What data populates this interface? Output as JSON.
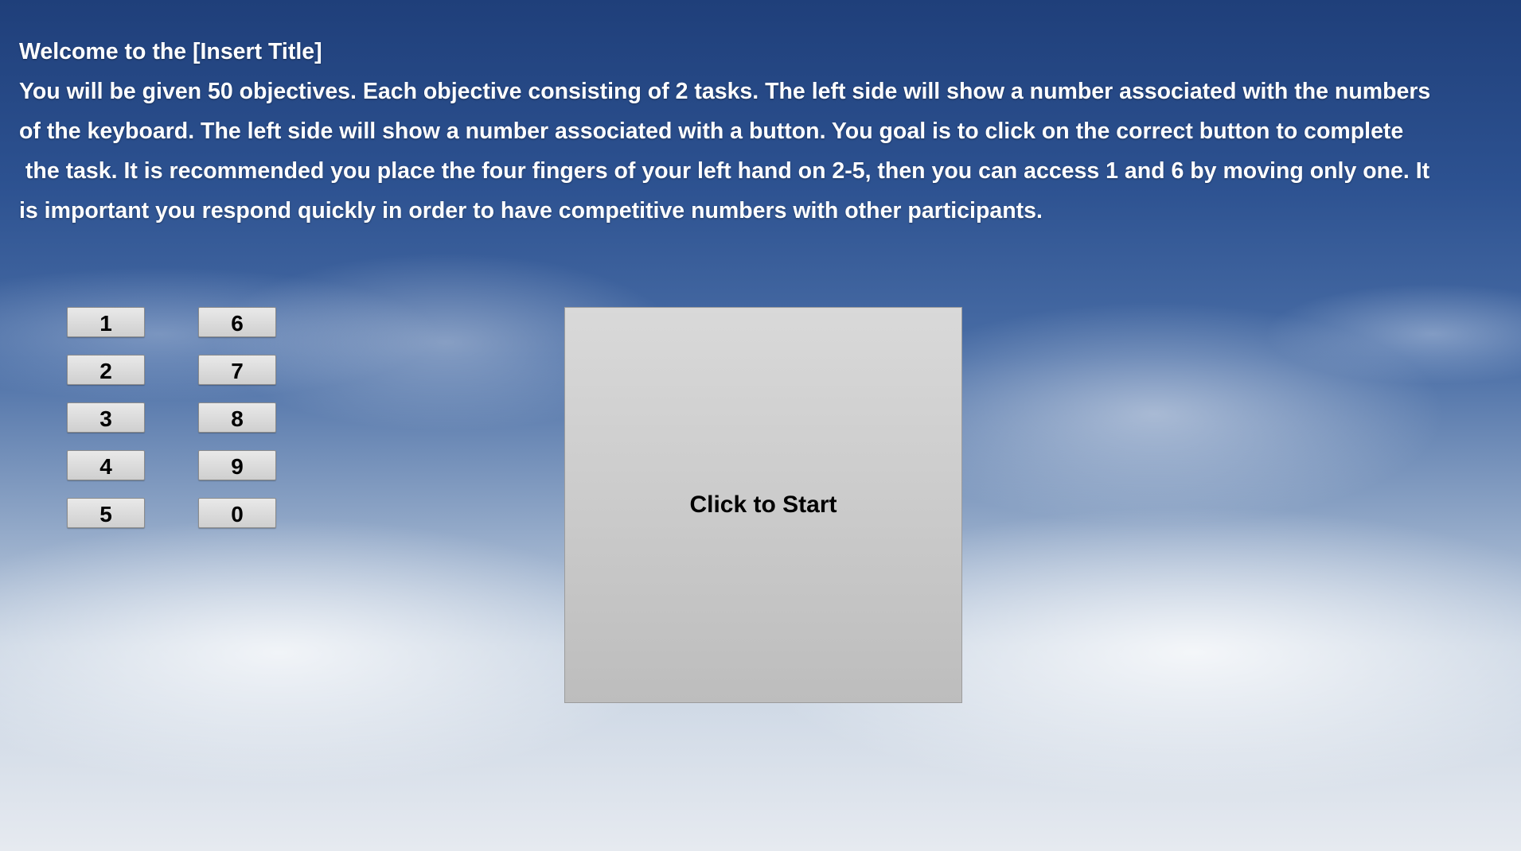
{
  "intro": {
    "title": "Welcome to the [Insert Title]",
    "lines": [
      "You will be given 50 objectives. Each objective consisting of 2 tasks. The left side will show a number associated with the numbers",
      "of the keyboard. The left side will show a number associated with a button. You goal is to click on the correct button to complete",
      " the task. It is recommended you place the four fingers of your left hand on 2-5, then you can access 1 and 6 by moving only one. It",
      "is important you respond quickly in order to have competitive numbers with other participants."
    ]
  },
  "keys": {
    "left": [
      "1",
      "2",
      "3",
      "4",
      "5"
    ],
    "right": [
      "6",
      "7",
      "8",
      "9",
      "0"
    ]
  },
  "start_button": {
    "label": "Click to Start"
  },
  "colors": {
    "text": "#ffffff",
    "button_top": "#e9e9e9",
    "button_bottom": "#cfcfcf",
    "sky_top": "#1f3f7a",
    "sky_bottom": "#e6eaf0"
  }
}
